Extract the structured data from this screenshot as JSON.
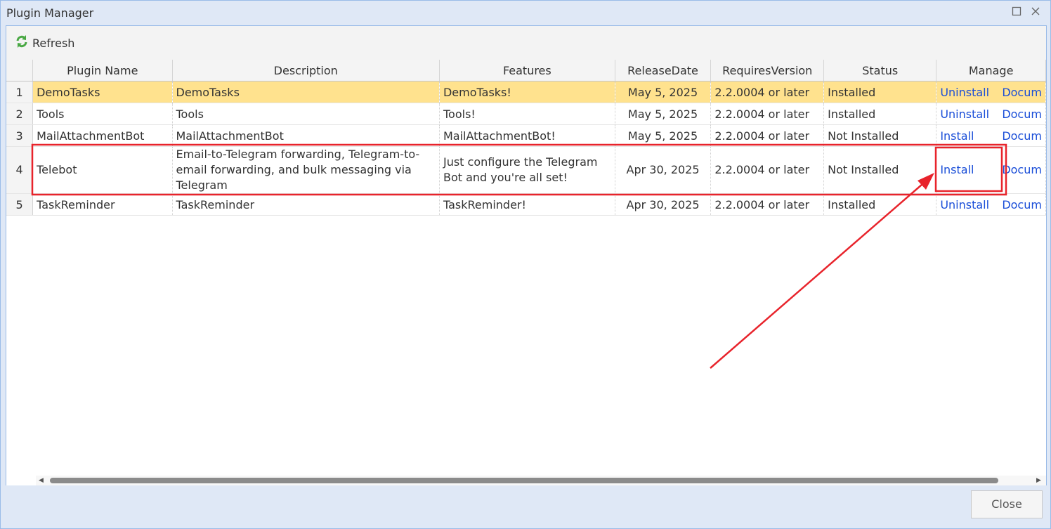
{
  "window": {
    "title": "Plugin Manager",
    "maximize_icon": "square-icon",
    "close_icon": "close-icon"
  },
  "toolbar": {
    "refresh_label": "Refresh",
    "refresh_icon": "refresh-icon"
  },
  "grid": {
    "columns": [
      "Plugin Name",
      "Description",
      "Features",
      "ReleaseDate",
      "RequiresVersion",
      "Status",
      "Manage"
    ],
    "rows": [
      {
        "num": "1",
        "name": "DemoTasks",
        "description": "DemoTasks",
        "features": "DemoTasks!",
        "release": "May 5, 2025",
        "requires": "2.2.0004 or later",
        "status": "Installed",
        "action": "Uninstall",
        "doc": "Docum"
      },
      {
        "num": "2",
        "name": "Tools",
        "description": "Tools",
        "features": "Tools!",
        "release": "May 5, 2025",
        "requires": "2.2.0004 or later",
        "status": "Installed",
        "action": "Uninstall",
        "doc": "Docum"
      },
      {
        "num": "3",
        "name": "MailAttachmentBot",
        "description": "MailAttachmentBot",
        "features": "MailAttachmentBot!",
        "release": "May 5, 2025",
        "requires": "2.2.0004 or later",
        "status": "Not Installed",
        "action": "Install",
        "doc": "Docum"
      },
      {
        "num": "4",
        "name": "Telebot",
        "description": "Email-to-Telegram forwarding, Telegram-to-email forwarding, and bulk messaging via Telegram",
        "features": "Just configure the Telegram Bot and you're all set!",
        "release": "Apr 30, 2025",
        "requires": "2.2.0004 or later",
        "status": "Not Installed",
        "action": "Install",
        "doc": "Docum"
      },
      {
        "num": "5",
        "name": "TaskReminder",
        "description": "TaskReminder",
        "features": "TaskReminder!",
        "release": "Apr 30, 2025",
        "requires": "2.2.0004 or later",
        "status": "Installed",
        "action": "Uninstall",
        "doc": "Docum"
      }
    ],
    "selected_row": 1
  },
  "footer": {
    "close_label": "Close"
  },
  "annotation": {
    "color": "#e8232b"
  }
}
